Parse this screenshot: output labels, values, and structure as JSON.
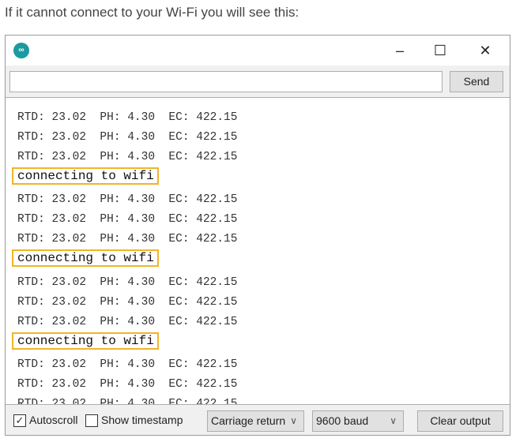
{
  "caption": "If it cannot connect to your Wi-Fi you will see this:",
  "window": {
    "logo": "arduino-logo",
    "minimize": "–",
    "maximize": "☐",
    "close": "✕"
  },
  "input": {
    "value": "",
    "send_label": "Send"
  },
  "output": {
    "lines": [
      {
        "text": "RTD: 23.02  PH: 4.30  EC: 422.15",
        "highlight": false
      },
      {
        "text": "RTD: 23.02  PH: 4.30  EC: 422.15",
        "highlight": false
      },
      {
        "text": "RTD: 23.02  PH: 4.30  EC: 422.15",
        "highlight": false
      },
      {
        "text": "connecting to wifi",
        "highlight": true
      },
      {
        "text": "RTD: 23.02  PH: 4.30  EC: 422.15",
        "highlight": false
      },
      {
        "text": "RTD: 23.02  PH: 4.30  EC: 422.15",
        "highlight": false
      },
      {
        "text": "RTD: 23.02  PH: 4.30  EC: 422.15",
        "highlight": false
      },
      {
        "text": "connecting to wifi",
        "highlight": true
      },
      {
        "text": "RTD: 23.02  PH: 4.30  EC: 422.15",
        "highlight": false
      },
      {
        "text": "RTD: 23.02  PH: 4.30  EC: 422.15",
        "highlight": false
      },
      {
        "text": "RTD: 23.02  PH: 4.30  EC: 422.15",
        "highlight": false
      },
      {
        "text": "connecting to wifi",
        "highlight": true
      },
      {
        "text": "RTD: 23.02  PH: 4.30  EC: 422.15",
        "highlight": false
      },
      {
        "text": "RTD: 23.02  PH: 4.30  EC: 422.15",
        "highlight": false
      },
      {
        "text": "RTD: 23.02  PH: 4.30  EC: 422.15",
        "highlight": false
      }
    ],
    "highlight_color": "#f0b429"
  },
  "bottom": {
    "autoscroll_label": "Autoscroll",
    "autoscroll_checked": true,
    "timestamp_label": "Show timestamp",
    "timestamp_checked": false,
    "line_ending": "Carriage return",
    "baud": "9600 baud",
    "clear_label": "Clear output"
  }
}
